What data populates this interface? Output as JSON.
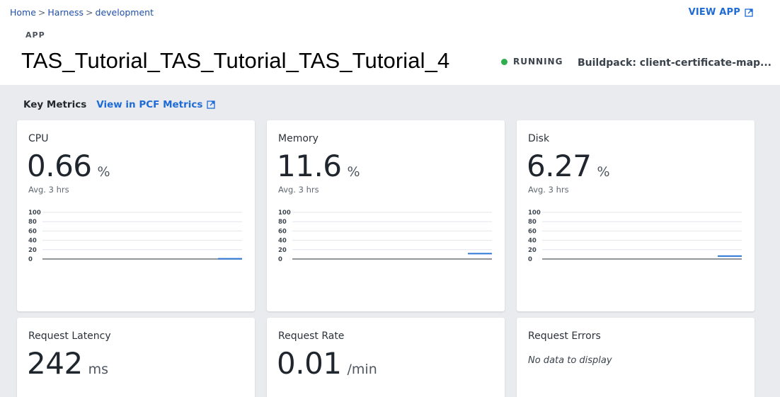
{
  "breadcrumb": [
    "Home",
    "Harness",
    "development"
  ],
  "breadcrumb_separator": ">",
  "view_app_label": "VIEW APP",
  "app_label": "APP",
  "app_title": "TAS_Tutorial_TAS_Tutorial_TAS_Tutorial_4",
  "status": {
    "text": "RUNNING",
    "color": "#2fae4e"
  },
  "buildpack": "Buildpack: client-certificate-map...",
  "key_metrics": {
    "title": "Key Metrics",
    "link_label": "View in PCF Metrics"
  },
  "colors": {
    "accent": "#1f6bd6",
    "chart_line": "#2f78d6",
    "background": "#e9ebee"
  },
  "metrics": [
    {
      "title": "CPU",
      "value": "0.66",
      "unit": "%",
      "subtitle": "Avg. 3 hrs"
    },
    {
      "title": "Memory",
      "value": "11.6",
      "unit": "%",
      "subtitle": "Avg. 3 hrs"
    },
    {
      "title": "Disk",
      "value": "6.27",
      "unit": "%",
      "subtitle": "Avg. 3 hrs"
    },
    {
      "title": "Request Latency",
      "value": "242",
      "unit": "ms"
    },
    {
      "title": "Request Rate",
      "value": "0.01",
      "unit": "/min"
    },
    {
      "title": "Request Errors",
      "no_data": "No data to display"
    }
  ],
  "chart_data": [
    {
      "type": "line",
      "name": "CPU",
      "yticks": [
        0,
        20,
        40,
        60,
        80,
        100
      ],
      "ylim": [
        0,
        100
      ],
      "series": [
        {
          "values": [
            0.66
          ]
        }
      ],
      "grid": true
    },
    {
      "type": "line",
      "name": "Memory",
      "yticks": [
        0,
        20,
        40,
        60,
        80,
        100
      ],
      "ylim": [
        0,
        100
      ],
      "series": [
        {
          "values": [
            11.6
          ]
        }
      ],
      "grid": true
    },
    {
      "type": "line",
      "name": "Disk",
      "yticks": [
        0,
        20,
        40,
        60,
        80,
        100
      ],
      "ylim": [
        0,
        100
      ],
      "series": [
        {
          "values": [
            6.27
          ]
        }
      ],
      "grid": true
    }
  ]
}
